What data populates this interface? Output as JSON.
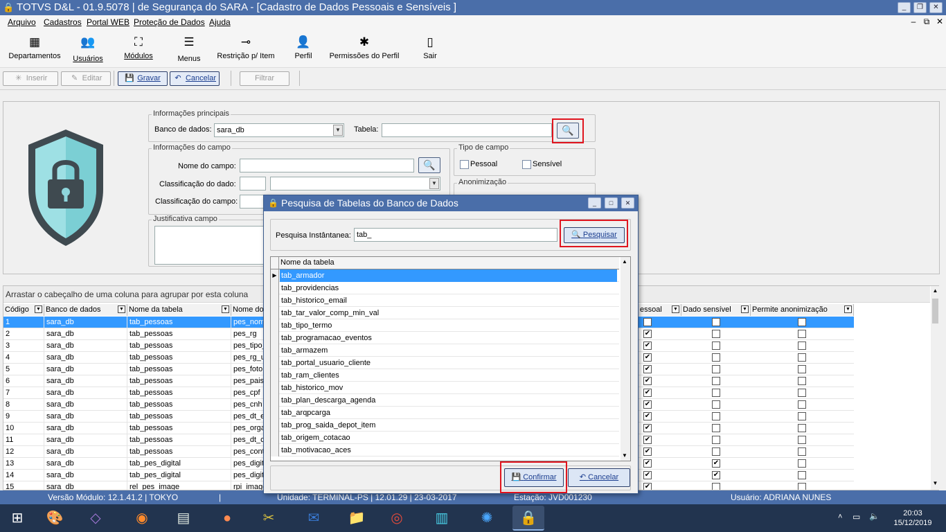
{
  "window": {
    "title": "TOTVS D&L - 01.9.5078 | de Segurança do SARA - [Cadastro de Dados Pessoais e Sensíveis ]"
  },
  "menu": [
    "Arquivo",
    "Cadastros",
    "Portal WEB",
    "Proteção de Dados",
    "Ajuda"
  ],
  "ribbon": [
    "Departamentos",
    "Usuários",
    "Módulos",
    "Menus",
    "Restrição p/ Item",
    "Perfil",
    "Permissões do Perfil",
    "Sair"
  ],
  "toolbar": {
    "inserir": "Inserir",
    "editar": "Editar",
    "gravar": "Gravar",
    "cancelar": "Cancelar",
    "filtrar": "Filtrar"
  },
  "form": {
    "principais_title": "Informações principais",
    "banco_label": "Banco de dados:",
    "banco_value": "sara_db",
    "tabela_label": "Tabela:",
    "tabela_value": "",
    "campo_title": "Informações do campo",
    "nome_campo_label": "Nome do campo:",
    "class_dado_label": "Classificação do dado:",
    "class_campo_label": "Classificação do campo:",
    "tipo_title": "Tipo de campo",
    "pessoal_label": "Pessoal",
    "sensivel_label": "Sensível",
    "anonim_title": "Anonimização",
    "justif_title": "Justificativa campo"
  },
  "grid": {
    "group_hint": "Arrastar o cabeçalho de uma coluna para agrupar por esta coluna",
    "headers": [
      "Código",
      "Banco de dados",
      "Nome da tabela",
      "Nome do",
      "essoal",
      "Dado sensível",
      "Permite anonimização"
    ],
    "rows": [
      [
        "1",
        "sara_db",
        "tab_pessoas",
        "pes_nom"
      ],
      [
        "2",
        "sara_db",
        "tab_pessoas",
        "pes_rg"
      ],
      [
        "3",
        "sara_db",
        "tab_pessoas",
        "pes_tipo_"
      ],
      [
        "4",
        "sara_db",
        "tab_pessoas",
        "pes_rg_u"
      ],
      [
        "5",
        "sara_db",
        "tab_pessoas",
        "pes_foto"
      ],
      [
        "6",
        "sara_db",
        "tab_pessoas",
        "pes_pais"
      ],
      [
        "7",
        "sara_db",
        "tab_pessoas",
        "pes_cpf"
      ],
      [
        "8",
        "sara_db",
        "tab_pessoas",
        "pes_cnh"
      ],
      [
        "9",
        "sara_db",
        "tab_pessoas",
        "pes_dt_e"
      ],
      [
        "10",
        "sara_db",
        "tab_pessoas",
        "pes_orga"
      ],
      [
        "11",
        "sara_db",
        "tab_pessoas",
        "pes_dt_c"
      ],
      [
        "12",
        "sara_db",
        "tab_pessoas",
        "pes_cont"
      ],
      [
        "13",
        "sara_db",
        "tab_pes_digital",
        "pes_digit"
      ],
      [
        "14",
        "sara_db",
        "tab_pes_digital",
        "pes_digit"
      ],
      [
        "15",
        "sara_db",
        "rel_pes_image",
        "rpi_image"
      ]
    ],
    "sensivel_checked": [
      false,
      false,
      false,
      false,
      false,
      false,
      false,
      false,
      false,
      false,
      false,
      false,
      true,
      true,
      false
    ]
  },
  "dialog": {
    "title": "Pesquisa de Tabelas do Banco de Dados",
    "search_label": "Pesquisa Instântanea:",
    "search_value": "tab_",
    "search_button": "Pesquisar",
    "list_header": "Nome da tabela",
    "items": [
      "tab_armador",
      "tab_providencias",
      "tab_historico_email",
      "tab_tar_valor_comp_min_val",
      "tab_tipo_termo",
      "tab_programacao_eventos",
      "tab_armazem",
      "tab_portal_usuario_cliente",
      "tab_ram_clientes",
      "tab_historico_mov",
      "tab_plan_descarga_agenda",
      "tab_arqpcarga",
      "tab_prog_saida_depot_item",
      "tab_origem_cotacao",
      "tab_motivacao_aces"
    ],
    "confirm": "Confirmar",
    "cancel": "Cancelar"
  },
  "status": {
    "versao": "Versão Módulo:  12.1.41.2  |  TOKYO",
    "unidade": "Unidade: TERMINAL-PS | 12.01.29 | 23-03-2017",
    "estacao": "Estação: JVD001230",
    "usuario": "Usuário: ADRIANA NUNES"
  },
  "clock": {
    "time": "20:03",
    "date": "15/12/2019"
  }
}
